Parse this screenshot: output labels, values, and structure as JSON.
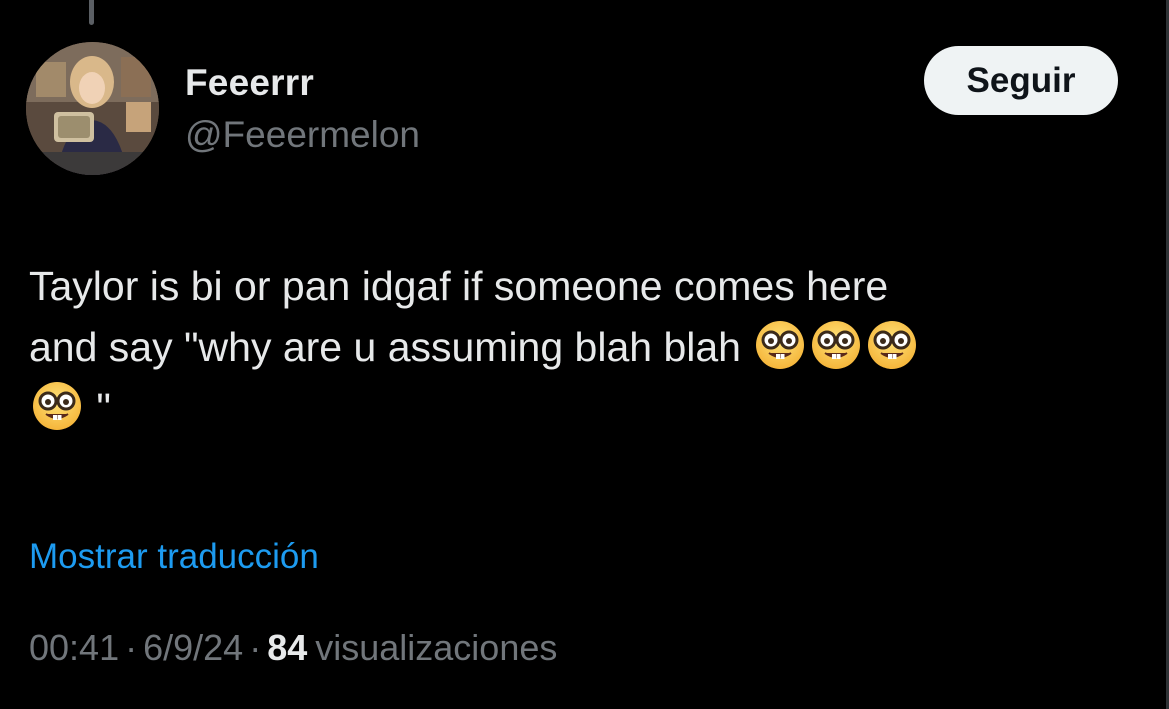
{
  "author": {
    "display_name": "Feeerrr",
    "handle": "@Feeermelon"
  },
  "follow_button_label": "Seguir",
  "tweet": {
    "line1": "Taylor is bi or pan idgaf if someone comes here",
    "line2": "and say \"why are u assuming blah blah",
    "line3_end": "\"",
    "emoji": "nerd-face"
  },
  "translate_link": "Mostrar traducción",
  "meta": {
    "time": "00:41",
    "separator": "·",
    "date": "6/9/24",
    "views_count": "84",
    "views_label": "visualizaciones"
  },
  "colors": {
    "background": "#000000",
    "text": "#e7e9ea",
    "secondary": "#71767b",
    "link": "#1d9bf0",
    "button_bg": "#eff3f4"
  }
}
